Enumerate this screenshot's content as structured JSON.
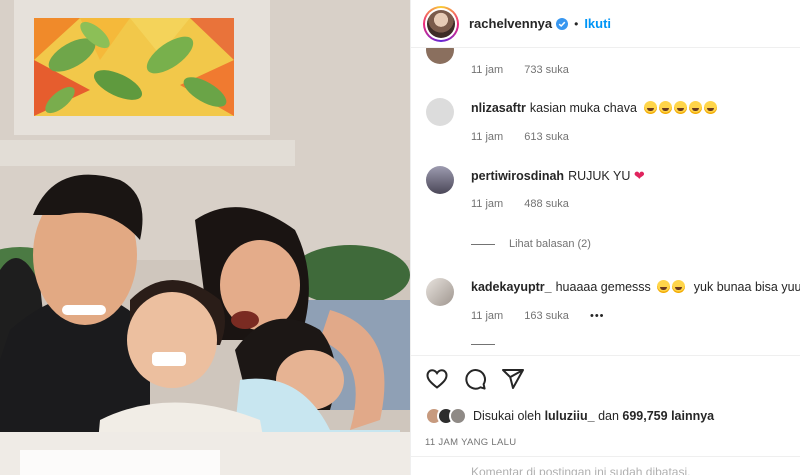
{
  "header": {
    "username": "rachelvennya",
    "separator": "•",
    "follow_label": "Ikuti"
  },
  "comments": [
    {
      "user": "",
      "text": "",
      "time": "11 jam",
      "likes": "733 suka",
      "avatar_color": "#8a6f5e"
    },
    {
      "user": "nlizasaftr",
      "text": "kasian muka chava",
      "emoji_count": 5,
      "time": "11 jam",
      "likes": "613 suka",
      "avatar_color": "#d9d9d9"
    },
    {
      "user": "pertiwirosdinah",
      "text": "RUJUK YU",
      "time": "11 jam",
      "likes": "488 suka",
      "avatar_color": "#6e6a78"
    },
    {
      "user": "kadekayuptr_",
      "text": "huaaaa gemesss",
      "text2": "yuk bunaa bisa yuuuu",
      "time": "11 jam",
      "likes": "163 suka",
      "avatar_color": "#c8c2bd"
    }
  ],
  "replies": {
    "view_label": "Lihat balasan (2)"
  },
  "more_label": "•••",
  "likes": {
    "prefix": "Disukai oleh",
    "user": "luluziiu_",
    "middle": "dan",
    "count": "699,759 lainnya"
  },
  "time_ago": "11 JAM YANG LALU",
  "add_comment_placeholder": "Komentar di postingan ini sudah dibatasi.",
  "colors": {
    "follow": "#0095f6",
    "heart": "#e0245e",
    "verified": "#3897f0"
  },
  "icons": [
    "heart-icon",
    "comment-icon",
    "share-icon",
    "verified-icon"
  ]
}
